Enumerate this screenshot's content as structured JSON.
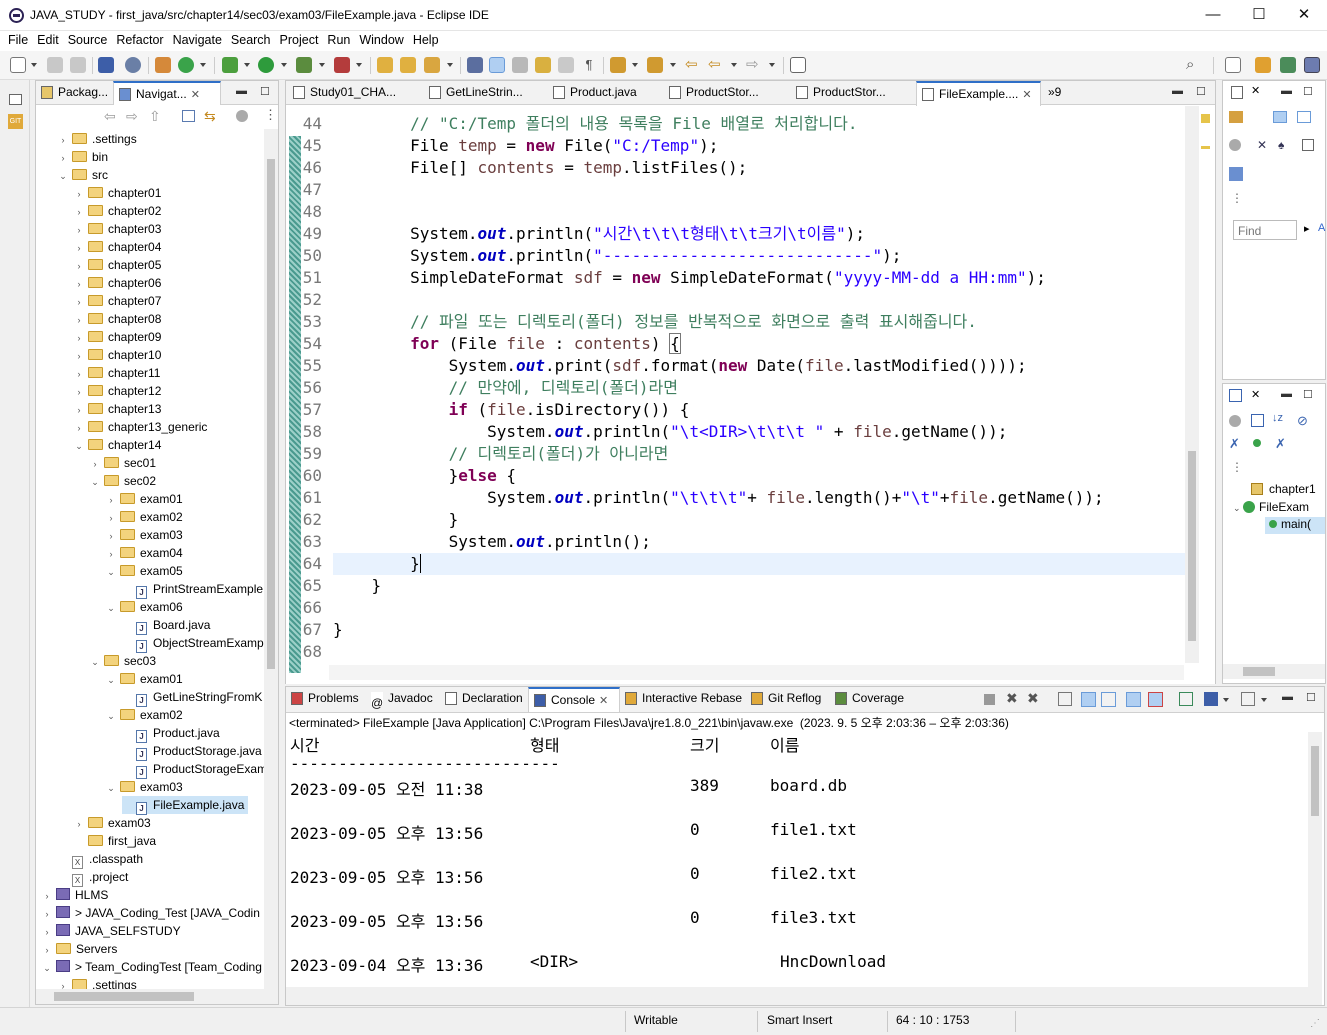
{
  "window": {
    "title": "JAVA_STUDY - first_java/src/chapter14/sec03/exam03/FileExample.java - Eclipse IDE"
  },
  "menu": [
    "File",
    "Edit",
    "Source",
    "Refactor",
    "Navigate",
    "Search",
    "Project",
    "Run",
    "Window",
    "Help"
  ],
  "left_panel": {
    "tabs": [
      "Packag...",
      "Navigat..."
    ],
    "tree": [
      {
        "label": ".settings",
        "depth": 1,
        "arrow": "›",
        "icon": "folder"
      },
      {
        "label": "bin",
        "depth": 1,
        "arrow": "›",
        "icon": "folder"
      },
      {
        "label": "src",
        "depth": 1,
        "arrow": "⌄",
        "icon": "folder"
      },
      {
        "label": "chapter01",
        "depth": 2,
        "arrow": "›",
        "icon": "folder"
      },
      {
        "label": "chapter02",
        "depth": 2,
        "arrow": "›",
        "icon": "folder"
      },
      {
        "label": "chapter03",
        "depth": 2,
        "arrow": "›",
        "icon": "folder"
      },
      {
        "label": "chapter04",
        "depth": 2,
        "arrow": "›",
        "icon": "folder"
      },
      {
        "label": "chapter05",
        "depth": 2,
        "arrow": "›",
        "icon": "folder"
      },
      {
        "label": "chapter06",
        "depth": 2,
        "arrow": "›",
        "icon": "folder"
      },
      {
        "label": "chapter07",
        "depth": 2,
        "arrow": "›",
        "icon": "folder"
      },
      {
        "label": "chapter08",
        "depth": 2,
        "arrow": "›",
        "icon": "folder"
      },
      {
        "label": "chapter09",
        "depth": 2,
        "arrow": "›",
        "icon": "folder"
      },
      {
        "label": "chapter10",
        "depth": 2,
        "arrow": "›",
        "icon": "folder"
      },
      {
        "label": "chapter11",
        "depth": 2,
        "arrow": "›",
        "icon": "folder"
      },
      {
        "label": "chapter12",
        "depth": 2,
        "arrow": "›",
        "icon": "folder"
      },
      {
        "label": "chapter13",
        "depth": 2,
        "arrow": "›",
        "icon": "folder"
      },
      {
        "label": "chapter13_generic",
        "depth": 2,
        "arrow": "›",
        "icon": "folder"
      },
      {
        "label": "chapter14",
        "depth": 2,
        "arrow": "⌄",
        "icon": "folder"
      },
      {
        "label": "sec01",
        "depth": 3,
        "arrow": "›",
        "icon": "folder"
      },
      {
        "label": "sec02",
        "depth": 3,
        "arrow": "⌄",
        "icon": "folder"
      },
      {
        "label": "exam01",
        "depth": 4,
        "arrow": "›",
        "icon": "folder"
      },
      {
        "label": "exam02",
        "depth": 4,
        "arrow": "›",
        "icon": "folder"
      },
      {
        "label": "exam03",
        "depth": 4,
        "arrow": "›",
        "icon": "folder"
      },
      {
        "label": "exam04",
        "depth": 4,
        "arrow": "›",
        "icon": "folder"
      },
      {
        "label": "exam05",
        "depth": 4,
        "arrow": "⌄",
        "icon": "folder"
      },
      {
        "label": "PrintStreamExample",
        "depth": 5,
        "arrow": "",
        "icon": "java"
      },
      {
        "label": "exam06",
        "depth": 4,
        "arrow": "⌄",
        "icon": "folder"
      },
      {
        "label": "Board.java",
        "depth": 5,
        "arrow": "",
        "icon": "java"
      },
      {
        "label": "ObjectStreamExamp",
        "depth": 5,
        "arrow": "",
        "icon": "java"
      },
      {
        "label": "sec03",
        "depth": 3,
        "arrow": "⌄",
        "icon": "folder"
      },
      {
        "label": "exam01",
        "depth": 4,
        "arrow": "⌄",
        "icon": "folder"
      },
      {
        "label": "GetLineStringFromK",
        "depth": 5,
        "arrow": "",
        "icon": "java"
      },
      {
        "label": "exam02",
        "depth": 4,
        "arrow": "⌄",
        "icon": "folder"
      },
      {
        "label": "Product.java",
        "depth": 5,
        "arrow": "",
        "icon": "java"
      },
      {
        "label": "ProductStorage.java",
        "depth": 5,
        "arrow": "",
        "icon": "java"
      },
      {
        "label": "ProductStorageExam",
        "depth": 5,
        "arrow": "",
        "icon": "java"
      },
      {
        "label": "exam03",
        "depth": 4,
        "arrow": "⌄",
        "icon": "folder"
      },
      {
        "label": "FileExample.java",
        "depth": 5,
        "arrow": "",
        "icon": "java",
        "selected": true
      },
      {
        "label": "exam03",
        "depth": 2,
        "arrow": "›",
        "icon": "folder"
      },
      {
        "label": "first_java",
        "depth": 2,
        "arrow": "",
        "icon": "folder"
      },
      {
        "label": ".classpath",
        "depth": 1,
        "arrow": "",
        "icon": "xml"
      },
      {
        "label": ".project",
        "depth": 1,
        "arrow": "",
        "icon": "xml"
      },
      {
        "label": "HLMS",
        "depth": 0,
        "arrow": "›",
        "icon": "project"
      },
      {
        "label": "> JAVA_Coding_Test [JAVA_Codin",
        "depth": 0,
        "arrow": "›",
        "icon": "project"
      },
      {
        "label": "JAVA_SELFSTUDY",
        "depth": 0,
        "arrow": "›",
        "icon": "project"
      },
      {
        "label": "Servers",
        "depth": 0,
        "arrow": "›",
        "icon": "folder"
      },
      {
        "label": "> Team_CodingTest [Team_Coding",
        "depth": 0,
        "arrow": "⌄",
        "icon": "project"
      },
      {
        "label": ".settings",
        "depth": 1,
        "arrow": "›",
        "icon": "folder"
      }
    ]
  },
  "editor": {
    "tabs": [
      "Study01_CHA...",
      "GetLineStrin...",
      "Product.java",
      "ProductStor...",
      "ProductStor...",
      "FileExample...."
    ],
    "overflow_count": "»9",
    "line_numbers": [
      "44",
      "45",
      "46",
      "47",
      "48",
      "49",
      "50",
      "51",
      "52",
      "53",
      "54",
      "55",
      "56",
      "57",
      "58",
      "59",
      "60",
      "61",
      "62",
      "63",
      "64",
      "65",
      "66",
      "67",
      "68"
    ]
  },
  "right_panel": {
    "find_placeholder": "Find",
    "outline": [
      "chapter1",
      "FileExam",
      "main("
    ]
  },
  "console": {
    "tabs": [
      "Problems",
      "Javadoc",
      "Declaration",
      "Console",
      "Interactive Rebase",
      "Git Reflog",
      "Coverage"
    ],
    "header": "<terminated> FileExample [Java Application] C:\\Program Files\\Java\\jre1.8.0_221\\bin\\javaw.exe  (2023. 9. 5 오후 2:03:36 – 오후 2:03:36)",
    "col_headers": [
      "시간",
      "형태",
      "크기",
      "이름"
    ],
    "divider": "----------------------------",
    "rows": [
      {
        "time": "2023-09-05 오전 11:38",
        "type": "",
        "size": "389",
        "name": "board.db"
      },
      {
        "time": "2023-09-05 오후 13:56",
        "type": "",
        "size": "0",
        "name": "file1.txt"
      },
      {
        "time": "2023-09-05 오후 13:56",
        "type": "",
        "size": "0",
        "name": "file2.txt"
      },
      {
        "time": "2023-09-05 오후 13:56",
        "type": "",
        "size": "0",
        "name": "file3.txt"
      },
      {
        "time": "2023-09-04 오후 13:36",
        "type": "<DIR>",
        "size": "",
        "name": "HncDownload"
      }
    ]
  },
  "status": {
    "writable": "Writable",
    "insert": "Smart Insert",
    "position": "64 : 10 : 1753"
  }
}
